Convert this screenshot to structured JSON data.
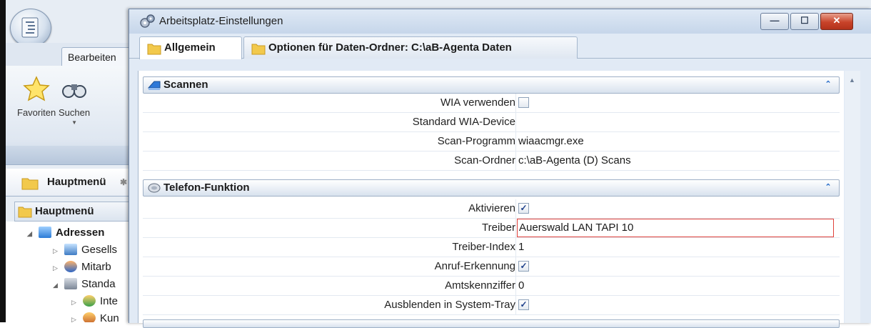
{
  "app": {
    "ribbon_tab": "Bearbeiten",
    "ribbon_buttons": [
      {
        "label": "Favoriten",
        "icon": "star-icon"
      },
      {
        "label": "Suchen",
        "icon": "binoculars-icon"
      }
    ],
    "nav_header": "Hauptmenü",
    "nav_sub": "Hauptmenü",
    "tree": [
      {
        "label": "Adressen",
        "bold": true
      },
      {
        "label": "Gesells"
      },
      {
        "label": "Mitarb"
      },
      {
        "label": "Standa"
      },
      {
        "label": "Inte"
      },
      {
        "label": "Kun"
      }
    ]
  },
  "dialog": {
    "title": "Arbeitsplatz-Einstellungen",
    "window_buttons": {
      "minimize": "—",
      "maximize": "☐",
      "close": "✕"
    },
    "tabs": [
      {
        "label": "Allgemein",
        "active": true
      },
      {
        "label": "Optionen für Daten-Ordner: C:\\aB-Agenta Daten",
        "active": false
      }
    ],
    "sections": [
      {
        "title": "Scannen",
        "rows": [
          {
            "label": "WIA verwenden",
            "type": "checkbox",
            "checked": false
          },
          {
            "label": "Standard WIA-Device",
            "type": "text",
            "value": ""
          },
          {
            "label": "Scan-Programm",
            "type": "text",
            "value": "wiaacmgr.exe"
          },
          {
            "label": "Scan-Ordner",
            "type": "text",
            "value": "c:\\aB-Agenta (D) Scans"
          }
        ]
      },
      {
        "title": "Telefon-Funktion",
        "rows": [
          {
            "label": "Aktivieren",
            "type": "checkbox",
            "checked": true
          },
          {
            "label": "Treiber",
            "type": "text",
            "value": "Auerswald LAN TAPI 10",
            "error": true
          },
          {
            "label": "Treiber-Index",
            "type": "text",
            "value": "1"
          },
          {
            "label": "Anruf-Erkennung",
            "type": "checkbox",
            "checked": true
          },
          {
            "label": "Amtskennziffer",
            "type": "text",
            "value": "0"
          },
          {
            "label": "Ausblenden in System-Tray",
            "type": "checkbox",
            "checked": true
          }
        ]
      }
    ]
  },
  "colors": {
    "accent": "#2a6dc9",
    "error_border": "#e0413a",
    "folder": "#f2c94c"
  }
}
